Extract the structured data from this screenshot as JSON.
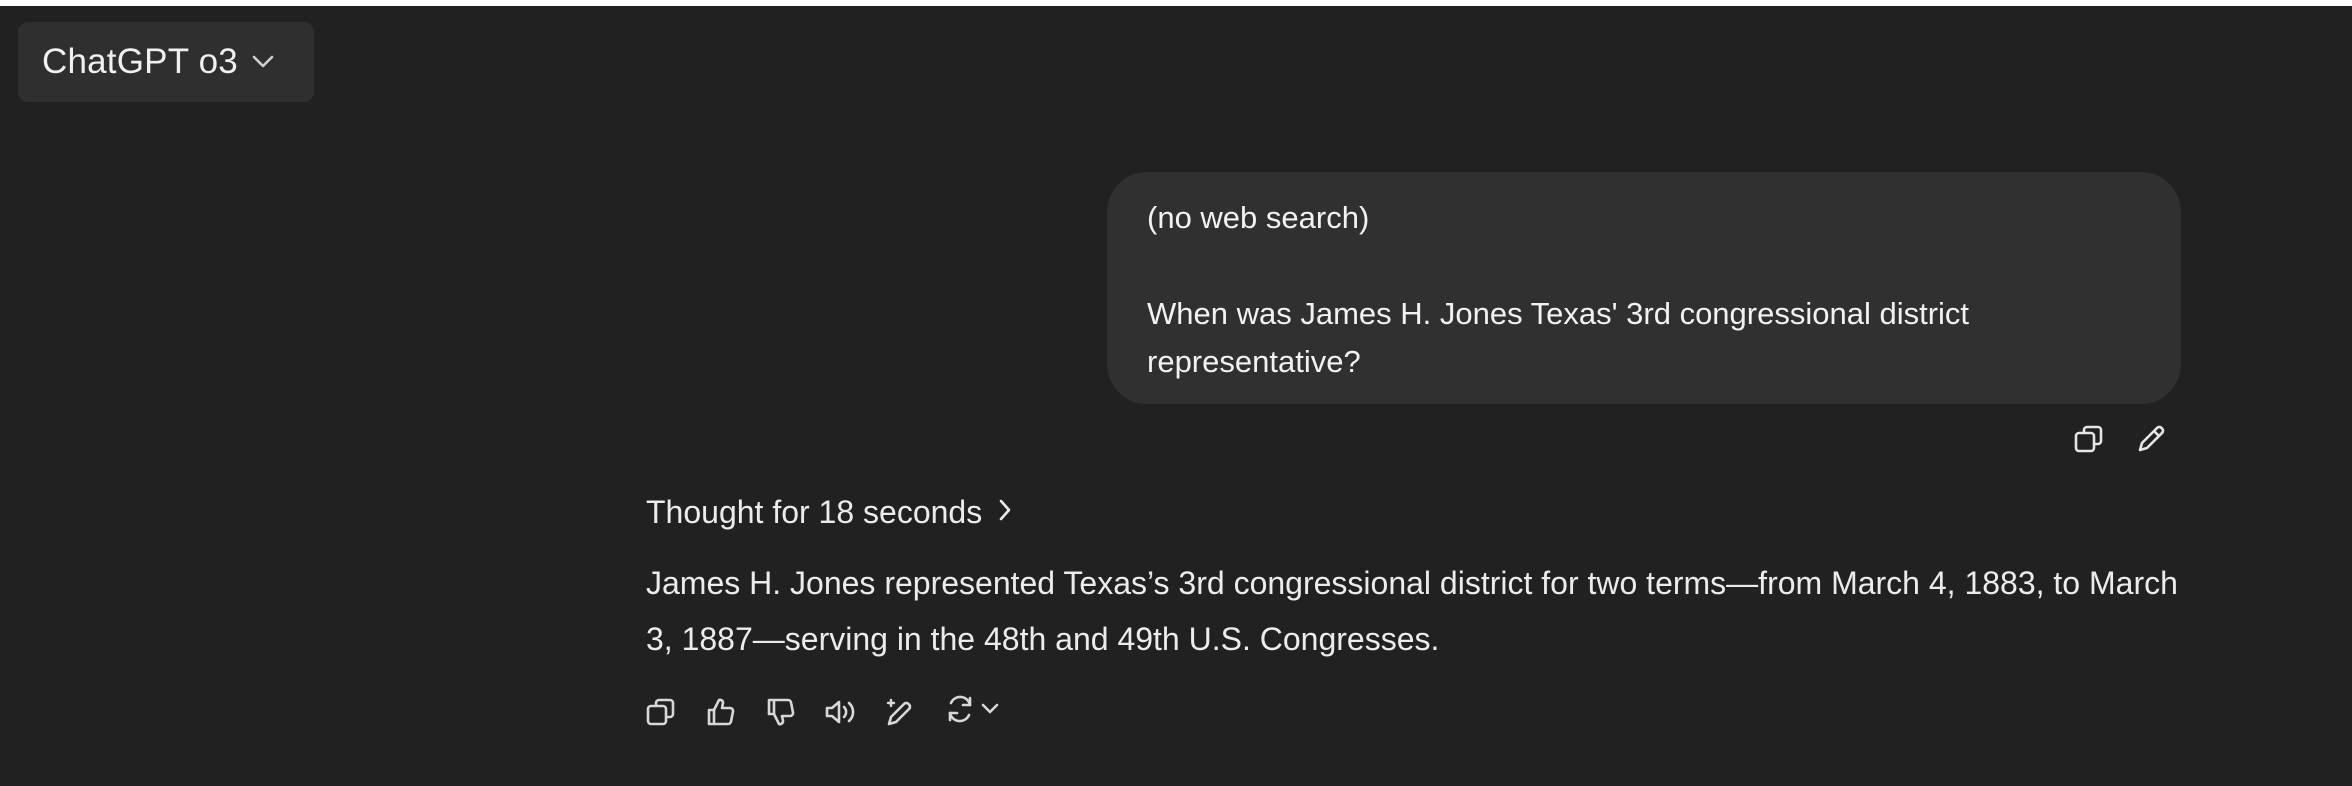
{
  "header": {
    "model_name": "ChatGPT o3",
    "model_dropdown_icon": "chevron-down-icon"
  },
  "conversation": {
    "user_message": {
      "line1": "(no web search)",
      "line2": "When was James H. Jones Texas' 3rd congressional district representative?",
      "actions": [
        "copy-icon",
        "edit-pencil-icon"
      ]
    },
    "assistant_message": {
      "thought_label": "Thought for 18 seconds",
      "thought_icon": "chevron-right-icon",
      "text": "James H. Jones represented Texas’s 3rd congressional district for two terms—from March 4, 1883, to March 3, 1887—serving in the 48th and 49th U.S. Congresses.",
      "actions": [
        "copy-icon",
        "thumbs-up-icon",
        "thumbs-down-icon",
        "read-aloud-icon",
        "edit-sparkle-icon",
        "regenerate-icon",
        "chevron-down-icon"
      ]
    }
  },
  "colors": {
    "background": "#212121",
    "bubble": "#303030",
    "switcher": "#2f2f2f",
    "text": "#ececec"
  }
}
